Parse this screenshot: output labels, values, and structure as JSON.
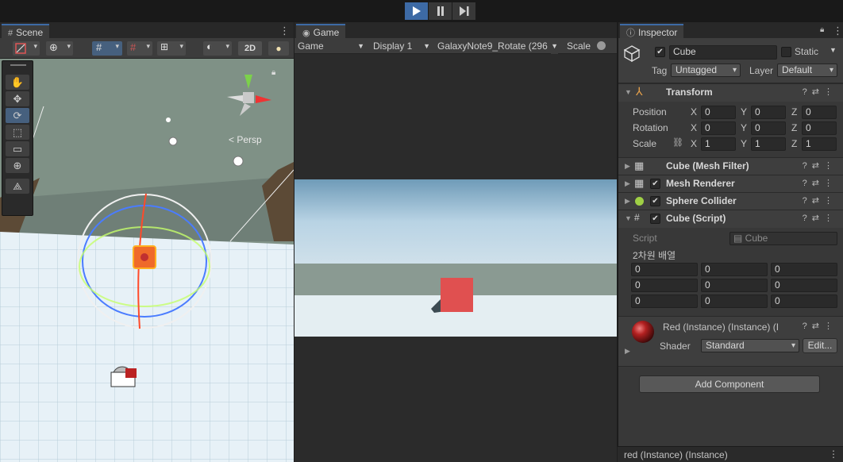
{
  "scene": {
    "tab_label": "Scene",
    "toolbar": {
      "mode_2d": "2D"
    },
    "persp_label": "< Persp"
  },
  "game": {
    "tab_label": "Game",
    "display_mode": "Game",
    "display": "Display 1",
    "resolution": "GalaxyNote9_Rotate (296",
    "scale_label": "Scale"
  },
  "inspector": {
    "tab_label": "Inspector",
    "object_name": "Cube",
    "static_label": "Static",
    "tag_label": "Tag",
    "tag_value": "Untagged",
    "layer_label": "Layer",
    "layer_value": "Default",
    "transform": {
      "title": "Transform",
      "position_label": "Position",
      "rotation_label": "Rotation",
      "scale_label": "Scale",
      "x": "X",
      "y": "Y",
      "z": "Z",
      "position": [
        "0",
        "0",
        "0"
      ],
      "rotation": [
        "0",
        "0",
        "0"
      ],
      "scale": [
        "1",
        "1",
        "1"
      ]
    },
    "components": [
      {
        "title": "Cube (Mesh Filter)"
      },
      {
        "title": "Mesh Renderer"
      },
      {
        "title": "Sphere Collider"
      },
      {
        "title": "Cube (Script)"
      }
    ],
    "script": {
      "script_label": "Script",
      "script_value": "Cube",
      "array_label": "2차원 배열",
      "grid": [
        [
          "0",
          "0",
          "0"
        ],
        [
          "0",
          "0",
          "0"
        ],
        [
          "0",
          "0",
          "0"
        ]
      ]
    },
    "material": {
      "name": "Red (Instance) (Instance) (I",
      "shader_label": "Shader",
      "shader_value": "Standard",
      "edit_label": "Edit..."
    },
    "add_component_label": "Add Component",
    "status_text": "red (Instance) (Instance)"
  },
  "colors": {
    "accent": "#3d6aa5",
    "cube_red": "#e05050",
    "sky": "#b9d7ea",
    "ground": "#e6f0f5"
  }
}
